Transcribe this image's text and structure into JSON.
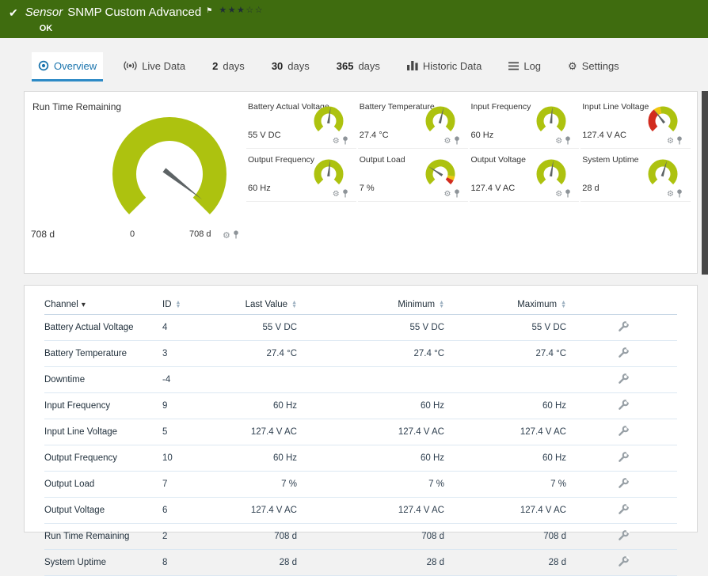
{
  "header": {
    "kind": "Sensor",
    "title": "SNMP Custom Advanced",
    "status": "OK",
    "stars_filled": 3,
    "stars_total": 5
  },
  "colors": {
    "header_bg": "#3f6c0f",
    "accent_blue": "#1a74ad",
    "gauge_green": "#adc20f",
    "gauge_yellow": "#efc50f",
    "gauge_red": "#d22c1f",
    "needle": "#5d6365"
  },
  "tabs": [
    {
      "key": "overview",
      "icon": "overview",
      "label": "Overview",
      "active": true
    },
    {
      "key": "live-data",
      "icon": "live",
      "label": "Live Data"
    },
    {
      "key": "2-days",
      "num": "2",
      "label": "days"
    },
    {
      "key": "30-days",
      "num": "30",
      "label": "days"
    },
    {
      "key": "365-days",
      "num": "365",
      "label": "days"
    },
    {
      "key": "historic-data",
      "icon": "chart",
      "label": "Historic Data"
    },
    {
      "key": "log",
      "icon": "log",
      "label": "Log"
    },
    {
      "key": "settings",
      "icon": "gear",
      "label": "Settings"
    }
  ],
  "big_gauge": {
    "title": "Run Time Remaining",
    "value": "708 d",
    "scale_min": "0",
    "scale_max": "708 d",
    "needle_deg": 128,
    "segments": [
      {
        "color": "#adc20f",
        "from": 0,
        "to": 1
      }
    ]
  },
  "small_gauges": [
    {
      "label": "Battery Actual Voltage",
      "value": "55 V DC",
      "needle_deg": 8,
      "segments": [
        {
          "color": "#adc20f",
          "from": 0,
          "to": 1
        }
      ]
    },
    {
      "label": "Battery Temperature",
      "value": "27.4 °C",
      "needle_deg": 14,
      "segments": [
        {
          "color": "#adc20f",
          "from": 0,
          "to": 1
        }
      ]
    },
    {
      "label": "Input Frequency",
      "value": "60 Hz",
      "needle_deg": 5,
      "segments": [
        {
          "color": "#adc20f",
          "from": 0,
          "to": 1
        }
      ]
    },
    {
      "label": "Input Line Voltage",
      "value": "127.4 V AC",
      "needle_deg": -38,
      "segments": [
        {
          "color": "#d22c1f",
          "from": 0,
          "to": 0.36
        },
        {
          "color": "#efc50f",
          "from": 0.36,
          "to": 0.46
        },
        {
          "color": "#adc20f",
          "from": 0.46,
          "to": 1
        }
      ]
    },
    {
      "label": "Output Frequency",
      "value": "60 Hz",
      "needle_deg": 6,
      "segments": [
        {
          "color": "#adc20f",
          "from": 0,
          "to": 1
        }
      ]
    },
    {
      "label": "Output Load",
      "value": "7 %",
      "needle_deg": -57,
      "segments": [
        {
          "color": "#adc20f",
          "from": 0,
          "to": 0.87
        },
        {
          "color": "#efc50f",
          "from": 0.87,
          "to": 0.93
        },
        {
          "color": "#d22c1f",
          "from": 0.93,
          "to": 1
        }
      ]
    },
    {
      "label": "Output Voltage",
      "value": "127.4 V AC",
      "needle_deg": 9,
      "segments": [
        {
          "color": "#adc20f",
          "from": 0,
          "to": 1
        }
      ]
    },
    {
      "label": "System Uptime",
      "value": "28 d",
      "needle_deg": 17,
      "segments": [
        {
          "color": "#adc20f",
          "from": 0,
          "to": 1
        }
      ]
    }
  ],
  "channel_table": {
    "columns": [
      {
        "label": "Channel",
        "sort": "desc",
        "align": "left"
      },
      {
        "label": "ID",
        "sort": "both",
        "align": "left"
      },
      {
        "label": "Last Value",
        "sort": "both",
        "align": "right"
      },
      {
        "label": "Minimum",
        "sort": "both",
        "align": "right"
      },
      {
        "label": "Maximum",
        "sort": "both",
        "align": "right"
      }
    ],
    "rows": [
      {
        "channel": "Battery Actual Voltage",
        "id": "4",
        "last": "55 V DC",
        "min": "55 V DC",
        "max": "55 V DC"
      },
      {
        "channel": "Battery Temperature",
        "id": "3",
        "last": "27.4 °C",
        "min": "27.4 °C",
        "max": "27.4 °C"
      },
      {
        "channel": "Downtime",
        "id": "-4",
        "last": "",
        "min": "",
        "max": ""
      },
      {
        "channel": "Input Frequency",
        "id": "9",
        "last": "60 Hz",
        "min": "60 Hz",
        "max": "60 Hz"
      },
      {
        "channel": "Input Line Voltage",
        "id": "5",
        "last": "127.4 V AC",
        "min": "127.4 V AC",
        "max": "127.4 V AC"
      },
      {
        "channel": "Output Frequency",
        "id": "10",
        "last": "60 Hz",
        "min": "60 Hz",
        "max": "60 Hz"
      },
      {
        "channel": "Output Load",
        "id": "7",
        "last": "7 %",
        "min": "7 %",
        "max": "7 %"
      },
      {
        "channel": "Output Voltage",
        "id": "6",
        "last": "127.4 V AC",
        "min": "127.4 V AC",
        "max": "127.4 V AC"
      },
      {
        "channel": "Run Time Remaining",
        "id": "2",
        "last": "708 d",
        "min": "708 d",
        "max": "708 d"
      },
      {
        "channel": "System Uptime",
        "id": "8",
        "last": "28 d",
        "min": "28 d",
        "max": "28 d"
      }
    ]
  }
}
